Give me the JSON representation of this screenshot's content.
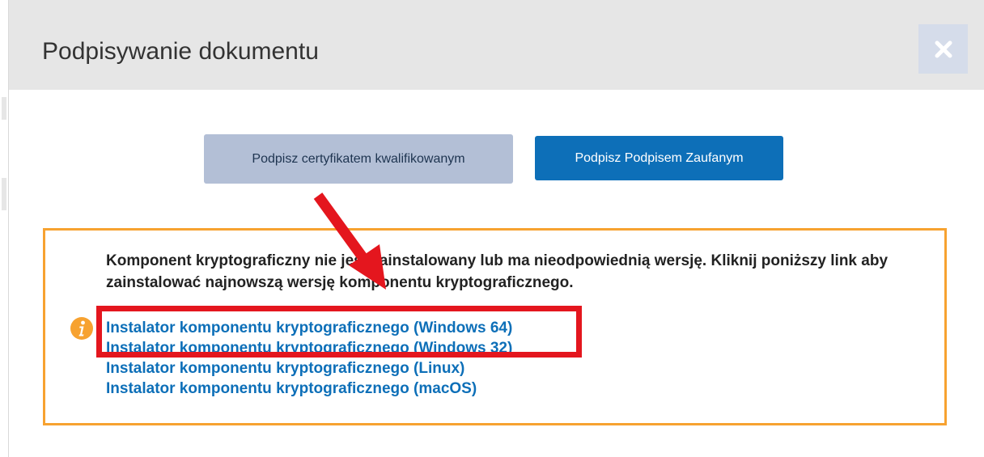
{
  "dialog": {
    "title": "Podpisywanie dokumentu",
    "close_icon": "close-icon"
  },
  "actions": {
    "cert_button_label": "Podpisz certyfikatem kwalifikowanym",
    "trusted_button_label": "Podpisz Podpisem Zaufanym"
  },
  "notice": {
    "icon": "info-icon",
    "message": "Komponent kryptograficzny nie jest zainstalowany lub ma nieodpowiednią wersję. Kliknij poniższy link aby zainstalować najnowszą wersję komponentu kryptograficznego.",
    "links": [
      {
        "label": "Instalator komponentu kryptograficznego (Windows 64)"
      },
      {
        "label": "Instalator komponentu kryptograficznego (Windows 32)"
      },
      {
        "label": "Instalator komponentu kryptograficznego (Linux)"
      },
      {
        "label": "Instalator komponentu kryptograficznego (macOS)"
      }
    ]
  },
  "annotation": {
    "highlight_color": "#e4161e",
    "accent_color": "#f7a230",
    "link_color": "#0d6fb8"
  }
}
